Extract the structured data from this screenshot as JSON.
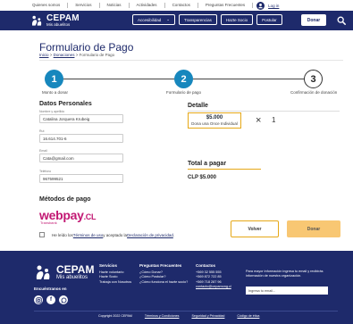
{
  "topnav": {
    "items": [
      "Quienes somos",
      "Servicios",
      "Noticias",
      "Actividades",
      "Contactos",
      "Preguntas Frecuentes"
    ],
    "login": "Log in"
  },
  "header": {
    "brand": "CEPAM",
    "brand_sub": "Mis abuelitos",
    "accessibility": "Accesibilidad",
    "transparency": "Transparencias",
    "volunteer": "Hazte Socio",
    "apply": "Postular",
    "donate": "Donar"
  },
  "page": {
    "title": "Formulario de Pago",
    "breadcrumb": [
      "Inicio",
      "Donaciones",
      "Formulario de Pago"
    ]
  },
  "steps": [
    {
      "number": "1",
      "label": "Monto a donar",
      "state": "done"
    },
    {
      "number": "2",
      "label": "Formulario de pago",
      "state": "done"
    },
    {
      "number": "3",
      "label": "Confirmación de donación",
      "state": "pending"
    }
  ],
  "personal": {
    "heading": "Datos Personales",
    "fields": [
      {
        "label": "Nombre y apellido",
        "value": "Catalina Jorquera Krubeig"
      },
      {
        "label": "Rut",
        "value": "16.614.701-6"
      },
      {
        "label": "Email",
        "value": "Cata@gmail.com"
      },
      {
        "label": "Teléfono",
        "value": "967599521"
      }
    ]
  },
  "payment": {
    "heading": "Métodos de pago",
    "webpay": "webpay",
    "webpay_suffix": ".CL",
    "webpay_sub": "Transbank"
  },
  "terms": {
    "prefix": "He leído los ",
    "tc": "Términos de uso",
    "mid": " y aceptado la ",
    "privacy": "Declaración de privacidad",
    "suffix": "."
  },
  "detail": {
    "heading": "Detalle",
    "item_price": "$5.000",
    "item_desc": "Dona una Once Individual",
    "times": "×",
    "quantity": "1",
    "total_heading": "Total a pagar",
    "total": "CLP $5.000"
  },
  "buttons": {
    "back": "Volver",
    "donate": "Donar"
  },
  "footer": {
    "brand": "CEPAM",
    "brand_sub": "Mis abuelitos",
    "follow": "Encuéntranos en",
    "socials": [
      "ig",
      "f",
      "in"
    ],
    "services": {
      "heading": "Servicios",
      "items": [
        "Hazte voluntario",
        "Hazte Socio",
        "Trabaja con Nosotros"
      ]
    },
    "faq": {
      "heading": "Preguntas Frecuentes",
      "items": [
        "¿Cómo Donar?",
        "¿Cómo Postular?",
        "¿Cómo funciona el hazte socio?"
      ]
    },
    "contact": {
      "heading": "Contactos",
      "items": [
        "+569 32 555 555",
        "+569 872 722 85",
        "+569 718 287 96",
        "contacto@cepamong.cl"
      ]
    },
    "newsletter": "Para mayor información ingresa tu email y recibirás información de nuestra organización.",
    "email_placeholder": "Ingresa tu email...",
    "copyright": "Copyright 2022 CEPAM",
    "legal": [
      "Términos y Condiciones",
      "Seguridad y Privacidad",
      "Código de ética"
    ]
  },
  "colors": {
    "navy": "#1e2a6b",
    "step_blue": "#1787bd",
    "gold": "#e6a817",
    "donate_btn": "#f8c773",
    "webpay_pink": "#c21873"
  }
}
